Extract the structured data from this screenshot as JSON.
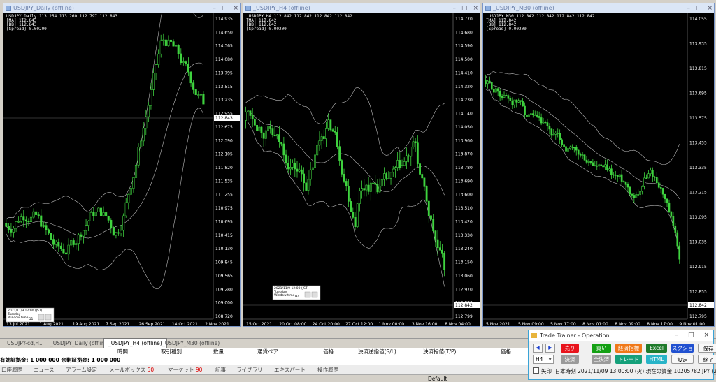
{
  "windows": [
    {
      "id": "daily",
      "title": "USDJPY_Daily (offline)",
      "info": [
        "USDJPY_Daily 113.254 113.260 112.797 112.843",
        "[MA] 112.843",
        "[BB] 112.843",
        "[Spread] 0.00200"
      ],
      "price_labels": [
        "114.935",
        "114.650",
        "114.365",
        "114.080",
        "113.795",
        "113.515",
        "113.235",
        "112.955",
        "112.675",
        "112.390",
        "112.105",
        "111.820",
        "111.535",
        "111.255",
        "110.975",
        "110.695",
        "110.415",
        "110.130",
        "109.845",
        "109.565",
        "109.280",
        "109.000",
        "108.720"
      ],
      "current_price": "112.843",
      "date_labels": [
        "13 Jul 2021",
        "1 Aug 2021",
        "19 Aug 2021",
        "7 Sep 2021",
        "26 Sep 2021",
        "14 Oct 2021",
        "2 Nov 2021"
      ],
      "popup": [
        "2021/11/9 12:00 (JST)",
        "Tuesday",
        "Window time",
        "D1"
      ]
    },
    {
      "id": "h4",
      "title": "_USDJPY_H4 (offline)",
      "info": [
        "_USDJPY_H4 112.842 112.842 112.842 112.842",
        "[MA] 112.842",
        "[BB] 112.842",
        "[Spread] 0.00200"
      ],
      "price_labels": [
        "114.770",
        "114.680",
        "114.590",
        "114.500",
        "114.410",
        "114.320",
        "114.230",
        "114.140",
        "114.050",
        "113.960",
        "113.870",
        "113.780",
        "113.690",
        "113.600",
        "113.510",
        "113.420",
        "113.330",
        "113.240",
        "113.150",
        "113.060",
        "112.970",
        "112.880",
        "112.799"
      ],
      "current_price": "112.842",
      "date_labels": [
        "15 Oct 2021",
        "20 Oct 08:00",
        "24 Oct 20:00",
        "27 Oct 12:00",
        "1 Nov 00:00",
        "3 Nov 16:00",
        "8 Nov 04:00"
      ],
      "popup": [
        "2021/11/9 12:00 (JST)",
        "Tuesday",
        "Window time",
        "H4"
      ]
    },
    {
      "id": "m30",
      "title": "_USDJPY_M30 (offline)",
      "info": [
        "_USDJPY_M30 112.842 112.842 112.842 112.842",
        "[MA] 112.842",
        "[BB] 112.842",
        "[Spread] 0.00200"
      ],
      "price_labels": [
        "114.055",
        "113.935",
        "113.815",
        "113.695",
        "113.575",
        "113.455",
        "113.335",
        "113.215",
        "113.095",
        "113.035",
        "112.915",
        "112.855",
        "112.795"
      ],
      "current_price": "112.842",
      "date_labels": [
        "5 Nov 2021",
        "5 Nov 09:00",
        "5 Nov 17:00",
        "8 Nov 01:00",
        "8 Nov 09:00",
        "8 Nov 17:00",
        "9 Nov 01:00"
      ]
    }
  ],
  "chart_tabs": [
    "USDJPY-cd,H1",
    "_USDJPY_Daily (offline)",
    "_USDJPY_H4 (offline)",
    "_USDJPY_M30 (offline)"
  ],
  "terminal": {
    "headers": [
      "時間",
      "取引種別",
      "数量",
      "通貨ペア",
      "価格",
      "決済逆指値(S/L)",
      "決済指値(T/P)",
      "価格"
    ],
    "balance": "有効証拠金: 1 000 000   余剰証拠金: 1 000 000",
    "tabs": [
      {
        "label": "口座履歴"
      },
      {
        "label": "ニュース"
      },
      {
        "label": "アラーム設定"
      },
      {
        "label": "メールボックス",
        "badge": "50"
      },
      {
        "label": "マーケット",
        "badge": "90"
      },
      {
        "label": "記事"
      },
      {
        "label": "ライブラリ"
      },
      {
        "label": "エキスパート"
      },
      {
        "label": "操作履歴"
      }
    ],
    "status": "Default"
  },
  "trade_trainer": {
    "title": "Trade Trainer - Operation",
    "buttons_row1": [
      {
        "label": "売り",
        "color": "#e8141c"
      },
      {
        "label": "買い",
        "color": "#14a014"
      },
      {
        "label": "経済指標",
        "color": "#f07818"
      },
      {
        "label": "Excel",
        "color": "#1e7a2a"
      },
      {
        "label": "スクショ",
        "color": "#2050d0"
      },
      {
        "label": "保存",
        "color": ""
      }
    ],
    "buttons_row2": [
      {
        "label": "決済",
        "color": "#9a9a9a"
      },
      {
        "label": "全決済",
        "color": "#9a9a9a"
      },
      {
        "label": "トレード",
        "color": "#14a07a"
      },
      {
        "label": "HTML",
        "color": "#28b4c8"
      },
      {
        "label": "設定",
        "color": ""
      },
      {
        "label": "終了",
        "color": ""
      }
    ],
    "timeframe": "H4",
    "arrow_label": "矢印",
    "status_line": "日本時刻 2021/11/09 13:00:00 (火)   現在の資金 10205782 JPY (2.06%)"
  }
}
